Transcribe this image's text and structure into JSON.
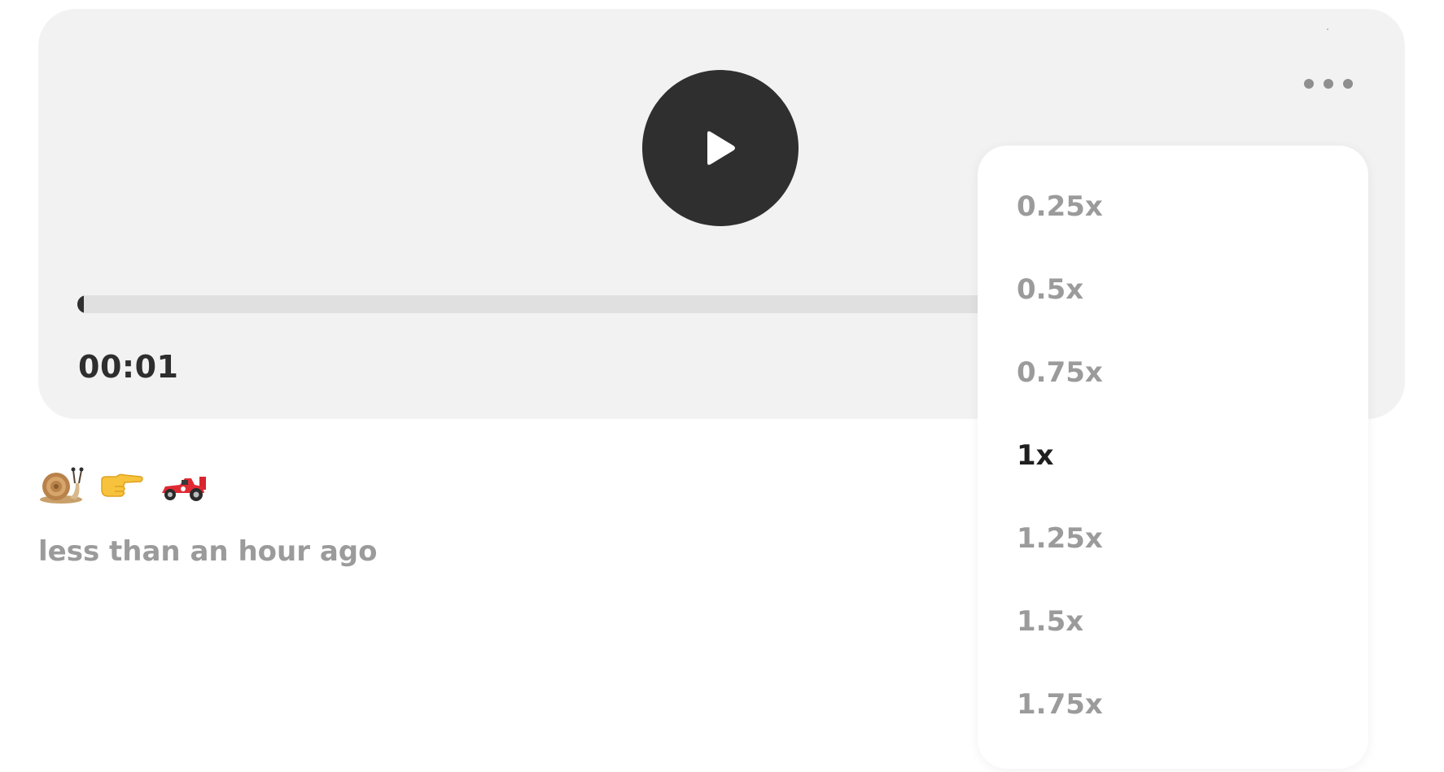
{
  "player": {
    "time": "00:01",
    "progress": 0.005,
    "more_icon": "ellipsis-icon",
    "play_icon": "play-icon"
  },
  "reaction": {
    "emojis": [
      "snail-emoji",
      "pointing-right-emoji",
      "race-car-emoji"
    ]
  },
  "timestamp": "less than an hour ago",
  "speed_menu": {
    "options": [
      {
        "label": "0.25x",
        "selected": false
      },
      {
        "label": "0.5x",
        "selected": false
      },
      {
        "label": "0.75x",
        "selected": false
      },
      {
        "label": "1x",
        "selected": true
      },
      {
        "label": "1.25x",
        "selected": false
      },
      {
        "label": "1.5x",
        "selected": false
      },
      {
        "label": "1.75x",
        "selected": false
      }
    ]
  },
  "colors": {
    "card": "#f2f2f2",
    "dark": "#2f2f2f",
    "muted": "#9b9b9b"
  }
}
